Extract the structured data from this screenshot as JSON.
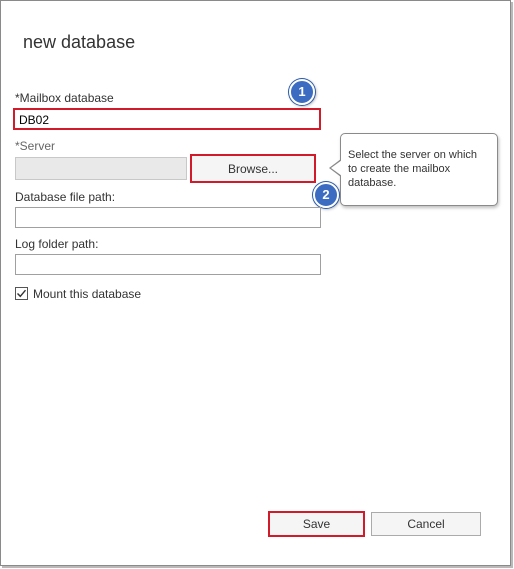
{
  "dialog": {
    "title": "new database"
  },
  "form": {
    "mailbox_database": {
      "label": "*Mailbox database",
      "value": "DB02"
    },
    "server": {
      "label": "*Server",
      "value": "",
      "browse_label": "Browse..."
    },
    "database_file_path": {
      "label": "Database file path:",
      "value": ""
    },
    "log_folder_path": {
      "label": "Log folder path:",
      "value": ""
    },
    "mount": {
      "label": "Mount this database",
      "checked": true
    }
  },
  "callouts": {
    "step1": "1",
    "step2": "2",
    "tooltip": "Select the server on which to create the mailbox database.",
    "highlight_color": "#d11a2a",
    "badge_color": "#3b6cc2"
  },
  "actions": {
    "save_label": "Save",
    "cancel_label": "Cancel"
  }
}
